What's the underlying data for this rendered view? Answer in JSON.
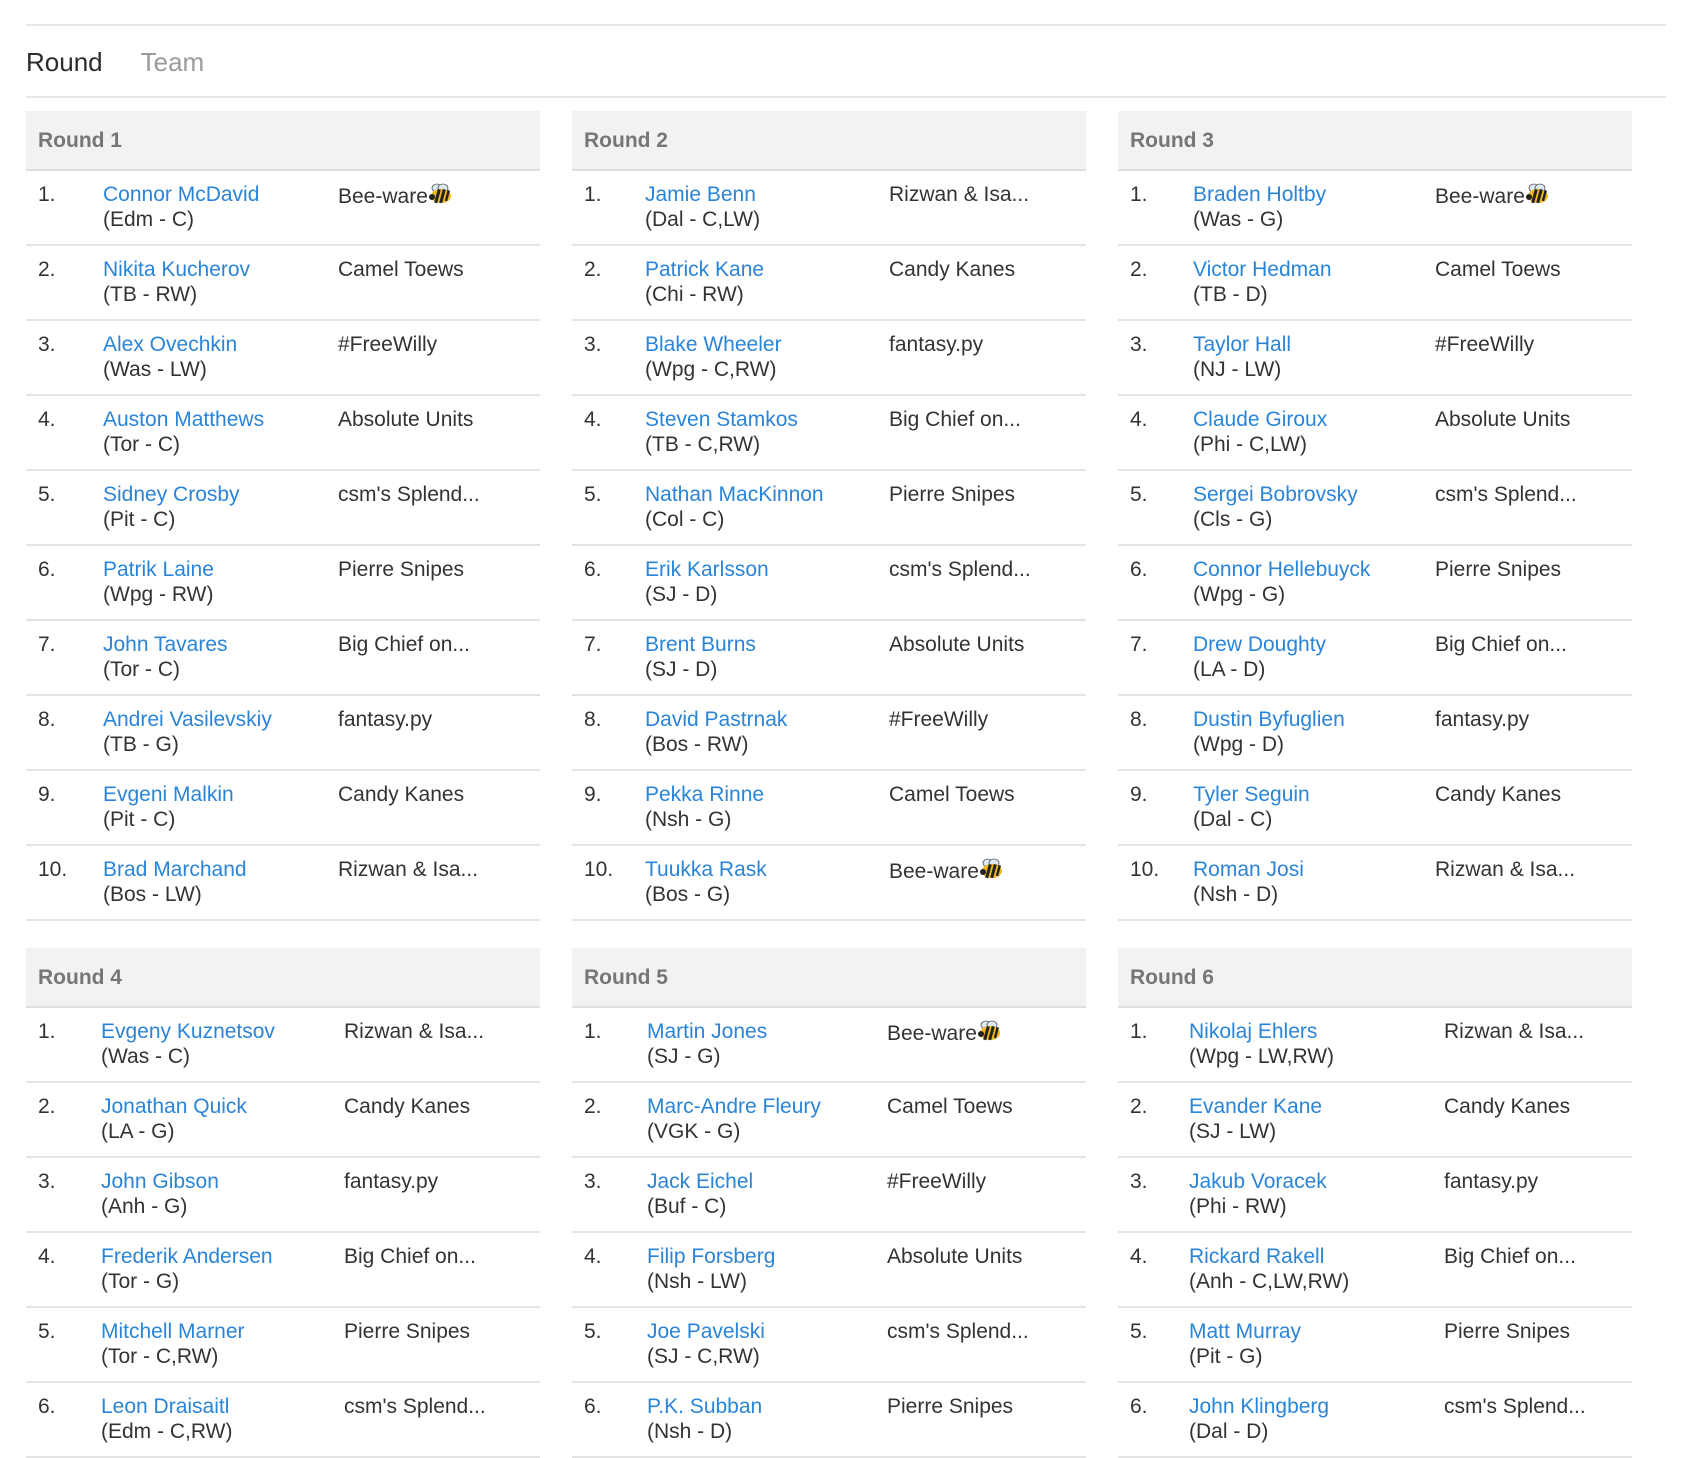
{
  "tabs": [
    "Round",
    "Team"
  ],
  "rounds": [
    {
      "title": "Round 1",
      "picks": [
        {
          "num": "1.",
          "name": "Connor McDavid",
          "info": "(Edm - C)",
          "team": "Bee-ware",
          "bee": true
        },
        {
          "num": "2.",
          "name": "Nikita Kucherov",
          "info": "(TB - RW)",
          "team": "Camel Toews"
        },
        {
          "num": "3.",
          "name": "Alex Ovechkin",
          "info": "(Was - LW)",
          "team": "#FreeWilly"
        },
        {
          "num": "4.",
          "name": "Auston Matthews",
          "info": "(Tor - C)",
          "team": "Absolute Units"
        },
        {
          "num": "5.",
          "name": "Sidney Crosby",
          "info": "(Pit - C)",
          "team": "csm's Splend..."
        },
        {
          "num": "6.",
          "name": "Patrik Laine",
          "info": "(Wpg - RW)",
          "team": "Pierre Snipes"
        },
        {
          "num": "7.",
          "name": "John Tavares",
          "info": "(Tor - C)",
          "team": "Big Chief on..."
        },
        {
          "num": "8.",
          "name": "Andrei Vasilevskiy",
          "info": "(TB - G)",
          "team": "fantasy.py"
        },
        {
          "num": "9.",
          "name": "Evgeni Malkin",
          "info": "(Pit - C)",
          "team": "Candy Kanes"
        },
        {
          "num": "10.",
          "name": "Brad Marchand",
          "info": "(Bos - LW)",
          "team": "Rizwan & Isa..."
        }
      ]
    },
    {
      "title": "Round 2",
      "picks": [
        {
          "num": "1.",
          "name": "Jamie Benn",
          "info": "(Dal - C,LW)",
          "team": "Rizwan & Isa..."
        },
        {
          "num": "2.",
          "name": "Patrick Kane",
          "info": "(Chi - RW)",
          "team": "Candy Kanes"
        },
        {
          "num": "3.",
          "name": "Blake Wheeler",
          "info": "(Wpg - C,RW)",
          "team": "fantasy.py"
        },
        {
          "num": "4.",
          "name": "Steven Stamkos",
          "info": "(TB - C,RW)",
          "team": "Big Chief on..."
        },
        {
          "num": "5.",
          "name": "Nathan MacKinnon",
          "info": "(Col - C)",
          "team": "Pierre Snipes"
        },
        {
          "num": "6.",
          "name": "Erik Karlsson",
          "info": "(SJ - D)",
          "team": "csm's Splend..."
        },
        {
          "num": "7.",
          "name": "Brent Burns",
          "info": "(SJ - D)",
          "team": "Absolute Units"
        },
        {
          "num": "8.",
          "name": "David Pastrnak",
          "info": "(Bos - RW)",
          "team": "#FreeWilly"
        },
        {
          "num": "9.",
          "name": "Pekka Rinne",
          "info": "(Nsh - G)",
          "team": "Camel Toews"
        },
        {
          "num": "10.",
          "name": "Tuukka Rask",
          "info": "(Bos - G)",
          "team": "Bee-ware",
          "bee": true
        }
      ]
    },
    {
      "title": "Round 3",
      "picks": [
        {
          "num": "1.",
          "name": "Braden Holtby",
          "info": "(Was - G)",
          "team": "Bee-ware",
          "bee": true
        },
        {
          "num": "2.",
          "name": "Victor Hedman",
          "info": "(TB - D)",
          "team": "Camel Toews"
        },
        {
          "num": "3.",
          "name": "Taylor Hall",
          "info": "(NJ - LW)",
          "team": "#FreeWilly"
        },
        {
          "num": "4.",
          "name": "Claude Giroux",
          "info": "(Phi - C,LW)",
          "team": "Absolute Units"
        },
        {
          "num": "5.",
          "name": "Sergei Bobrovsky",
          "info": "(Cls - G)",
          "team": "csm's Splend..."
        },
        {
          "num": "6.",
          "name": "Connor Hellebuyck",
          "info": "(Wpg - G)",
          "team": "Pierre Snipes"
        },
        {
          "num": "7.",
          "name": "Drew Doughty",
          "info": "(LA - D)",
          "team": "Big Chief on..."
        },
        {
          "num": "8.",
          "name": "Dustin Byfuglien",
          "info": "(Wpg - D)",
          "team": "fantasy.py"
        },
        {
          "num": "9.",
          "name": "Tyler Seguin",
          "info": "(Dal - C)",
          "team": "Candy Kanes"
        },
        {
          "num": "10.",
          "name": "Roman Josi",
          "info": "(Nsh - D)",
          "team": "Rizwan & Isa..."
        }
      ]
    },
    {
      "title": "Round 4",
      "picks": [
        {
          "num": "1.",
          "name": "Evgeny Kuznetsov",
          "info": "(Was - C)",
          "team": "Rizwan & Isa..."
        },
        {
          "num": "2.",
          "name": "Jonathan Quick",
          "info": "(LA - G)",
          "team": "Candy Kanes"
        },
        {
          "num": "3.",
          "name": "John Gibson",
          "info": "(Anh - G)",
          "team": "fantasy.py"
        },
        {
          "num": "4.",
          "name": "Frederik Andersen",
          "info": "(Tor - G)",
          "team": "Big Chief on..."
        },
        {
          "num": "5.",
          "name": "Mitchell Marner",
          "info": "(Tor - C,RW)",
          "team": "Pierre Snipes"
        },
        {
          "num": "6.",
          "name": "Leon Draisaitl",
          "info": "(Edm - C,RW)",
          "team": "csm's Splend..."
        }
      ]
    },
    {
      "title": "Round 5",
      "picks": [
        {
          "num": "1.",
          "name": "Martin Jones",
          "info": "(SJ - G)",
          "team": "Bee-ware",
          "bee": true
        },
        {
          "num": "2.",
          "name": "Marc-Andre Fleury",
          "info": "(VGK - G)",
          "team": "Camel Toews"
        },
        {
          "num": "3.",
          "name": "Jack Eichel",
          "info": "(Buf - C)",
          "team": "#FreeWilly"
        },
        {
          "num": "4.",
          "name": "Filip Forsberg",
          "info": "(Nsh - LW)",
          "team": "Absolute Units"
        },
        {
          "num": "5.",
          "name": "Joe Pavelski",
          "info": "(SJ - C,RW)",
          "team": "csm's Splend..."
        },
        {
          "num": "6.",
          "name": "P.K. Subban",
          "info": "(Nsh - D)",
          "team": "Pierre Snipes"
        }
      ]
    },
    {
      "title": "Round 6",
      "picks": [
        {
          "num": "1.",
          "name": "Nikolaj Ehlers",
          "info": "(Wpg - LW,RW)",
          "team": "Rizwan & Isa..."
        },
        {
          "num": "2.",
          "name": "Evander Kane",
          "info": "(SJ - LW)",
          "team": "Candy Kanes"
        },
        {
          "num": "3.",
          "name": "Jakub Voracek",
          "info": "(Phi - RW)",
          "team": "fantasy.py"
        },
        {
          "num": "4.",
          "name": "Rickard Rakell",
          "info": "(Anh - C,LW,RW)",
          "team": "Big Chief on..."
        },
        {
          "num": "5.",
          "name": "Matt Murray",
          "info": "(Pit - G)",
          "team": "Pierre Snipes"
        },
        {
          "num": "6.",
          "name": "John Klingberg",
          "info": "(Dal - D)",
          "team": "csm's Splend..."
        }
      ]
    }
  ]
}
